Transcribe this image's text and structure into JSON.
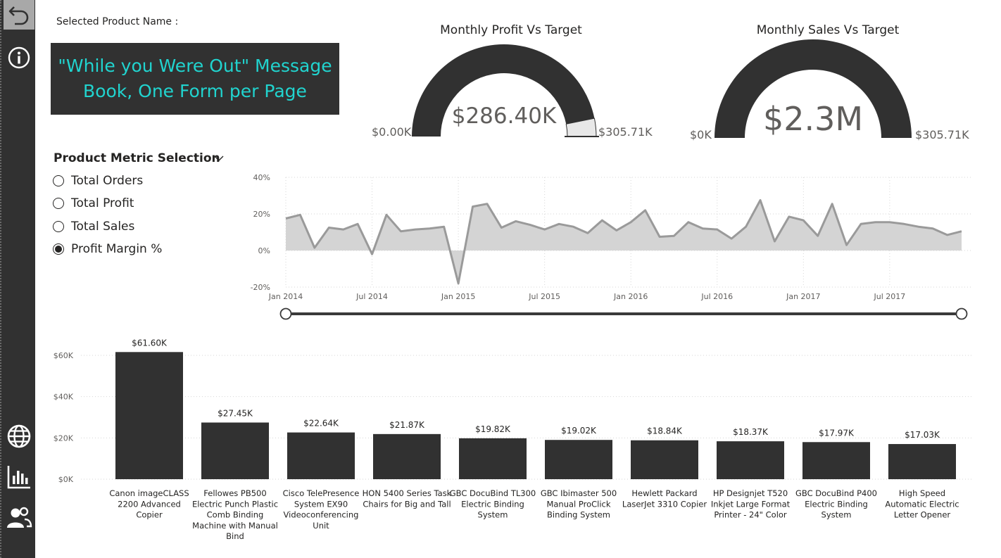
{
  "nav": {
    "back_icon": "undo-arrow-icon",
    "info_icon": "info-icon",
    "globe_icon": "globe-icon",
    "chart_icon": "bar-chart-icon",
    "people_icon": "people-icon"
  },
  "selected_product": {
    "label": "Selected Product Name :",
    "line1": "\"While you Were Out\" Message",
    "line2": "Book, One Form per Page",
    "text_color": "#21d4cf",
    "box_color": "#313131"
  },
  "gauges": [
    {
      "title": "Monthly Profit Vs Target",
      "value_label": "$286.40K",
      "min_label": "$0.00K",
      "max_label": "$305.71K",
      "value": 286.4,
      "target": 305.71,
      "fill_color": "#313131",
      "rest_color": "#e8e8e8"
    },
    {
      "title": "Monthly Sales Vs Target",
      "value_label": "$2.3M",
      "min_label": "$0K",
      "max_label": "$305.71K",
      "value": 2300,
      "target": 305.71,
      "fill_color": "#313131",
      "rest_color": "#e8e8e8"
    }
  ],
  "metric_slicer": {
    "title": "Product Metric Selection",
    "chevron_icon": "chevron-down-icon",
    "options": [
      {
        "label": "Total Orders",
        "selected": false
      },
      {
        "label": "Total Profit",
        "selected": false
      },
      {
        "label": "Total Sales",
        "selected": false
      },
      {
        "label": "Profit Margin %",
        "selected": true
      }
    ]
  },
  "date_slider": {
    "start": 0.0,
    "end": 1.0
  },
  "chart_data": [
    {
      "type": "area",
      "title": "",
      "xlabel": "",
      "ylabel": "",
      "ylim": [
        -20,
        40
      ],
      "y_ticks": [
        "40%",
        "20%",
        "0%",
        "-20%"
      ],
      "x_ticks": [
        "Jan 2014",
        "Jul 2014",
        "Jan 2015",
        "Jul 2015",
        "Jan 2016",
        "Jul 2016",
        "Jan 2017",
        "Jul 2017"
      ],
      "grid": true,
      "series": [
        {
          "x": [
            "2014-01",
            "2014-02",
            "2014-03",
            "2014-04",
            "2014-05",
            "2014-06",
            "2014-07",
            "2014-08",
            "2014-09",
            "2014-10",
            "2014-11",
            "2014-12",
            "2015-01",
            "2015-02",
            "2015-03",
            "2015-04",
            "2015-05",
            "2015-06",
            "2015-07",
            "2015-08",
            "2015-09",
            "2015-10",
            "2015-11",
            "2015-12",
            "2016-01",
            "2016-02",
            "2016-03",
            "2016-04",
            "2016-05",
            "2016-06",
            "2016-07",
            "2016-08",
            "2016-09",
            "2016-10",
            "2016-11",
            "2016-12",
            "2017-01",
            "2017-02",
            "2017-03",
            "2017-04",
            "2017-05",
            "2017-06",
            "2017-07",
            "2017-08",
            "2017-09",
            "2017-10",
            "2017-11",
            "2017-12"
          ],
          "values": [
            17.5,
            19.5,
            1.5,
            12.5,
            11.5,
            14.5,
            -2,
            19.5,
            10.5,
            11.5,
            12,
            13,
            -18,
            24,
            25.5,
            12.5,
            16,
            14,
            11.5,
            14.5,
            13,
            9.5,
            16.5,
            11,
            15.5,
            22,
            7.5,
            8,
            15.5,
            12,
            11.5,
            6.5,
            13,
            27.5,
            5,
            18.5,
            16.5,
            8,
            25.5,
            3,
            14.5,
            15.5,
            15.5,
            14.5,
            13,
            12,
            8.5,
            10.5
          ]
        }
      ]
    },
    {
      "type": "bar",
      "title": "",
      "xlabel": "",
      "ylabel": "",
      "ylim": [
        0,
        60
      ],
      "y_ticks": [
        "$60K",
        "$40K",
        "$20K",
        "$0K"
      ],
      "grid": true,
      "categories": [
        "Canon imageCLASS 2200 Advanced Copier",
        "Fellowes PB500 Electric Punch Plastic Comb Binding Machine with Manual Bind",
        "Cisco TelePresence System EX90 Videoconferencing Unit",
        "HON 5400 Series Task Chairs for Big and Tall",
        "GBC DocuBind TL300 Electric Binding System",
        "GBC Ibimaster 500 Manual ProClick Binding System",
        "Hewlett Packard LaserJet 3310 Copier",
        "HP Designjet T520 Inkjet Large Format Printer - 24\" Color",
        "GBC DocuBind P400 Electric Binding System",
        "High Speed Automatic Electric Letter Opener"
      ],
      "category_lines": [
        [
          "Canon imageCLASS",
          "2200 Advanced",
          "Copier"
        ],
        [
          "Fellowes PB500",
          "Electric Punch Plastic",
          "Comb Binding",
          "Machine with Manual",
          "Bind"
        ],
        [
          "Cisco TelePresence",
          "System EX90",
          "Videoconferencing",
          "Unit"
        ],
        [
          "HON 5400 Series Task",
          "Chairs for Big and Tall"
        ],
        [
          "GBC DocuBind TL300",
          "Electric Binding",
          "System"
        ],
        [
          "GBC Ibimaster 500",
          "Manual ProClick",
          "Binding System"
        ],
        [
          "Hewlett Packard",
          "LaserJet 3310 Copier"
        ],
        [
          "HP Designjet T520",
          "Inkjet Large Format",
          "Printer - 24\" Color"
        ],
        [
          "GBC DocuBind P400",
          "Electric Binding",
          "System"
        ],
        [
          "High Speed",
          "Automatic Electric",
          "Letter Opener"
        ]
      ],
      "values": [
        61.6,
        27.45,
        22.64,
        21.87,
        19.82,
        19.02,
        18.84,
        18.37,
        17.97,
        17.03
      ],
      "data_labels": [
        "$61.60K",
        "$27.45K",
        "$22.64K",
        "$21.87K",
        "$19.82K",
        "$19.02K",
        "$18.84K",
        "$18.37K",
        "$17.97K",
        "$17.03K"
      ],
      "bar_color": "#313131"
    }
  ]
}
